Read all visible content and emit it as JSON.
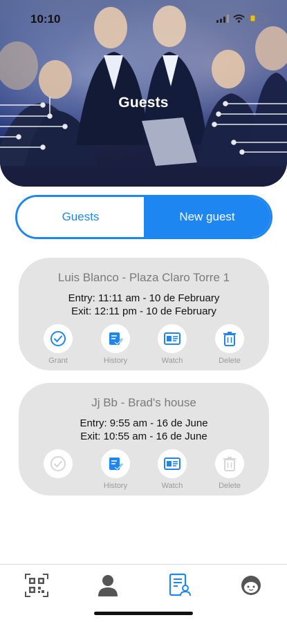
{
  "status_bar": {
    "time": "10:10"
  },
  "header": {
    "title": "Guests"
  },
  "tabs": {
    "left_label": "Guests",
    "right_label": "New guest"
  },
  "guests": [
    {
      "title": "Luis Blanco - Plaza Claro Torre 1",
      "entry": "Entry: 11:11 am - 10 de February",
      "exit": "Exit: 12:11 pm - 10 de February",
      "actions": {
        "grant": "Grant",
        "history": "History",
        "watch": "Watch",
        "delete": "Delete"
      }
    },
    {
      "title": "Jj Bb - Brad's house",
      "entry": "Entry: 9:55 am - 16 de June",
      "exit": "Exit: 10:55 am - 16 de June",
      "actions": {
        "history": "History",
        "watch": "Watch",
        "delete": "Delete"
      }
    }
  ],
  "bottom_nav": [
    "qr-code-icon",
    "person-icon",
    "guest-list-icon",
    "avatar-face-icon"
  ],
  "colors": {
    "accent": "#1e86f0",
    "card_bg": "#e4e4e4",
    "icon_disabled": "#cfcfcf"
  }
}
